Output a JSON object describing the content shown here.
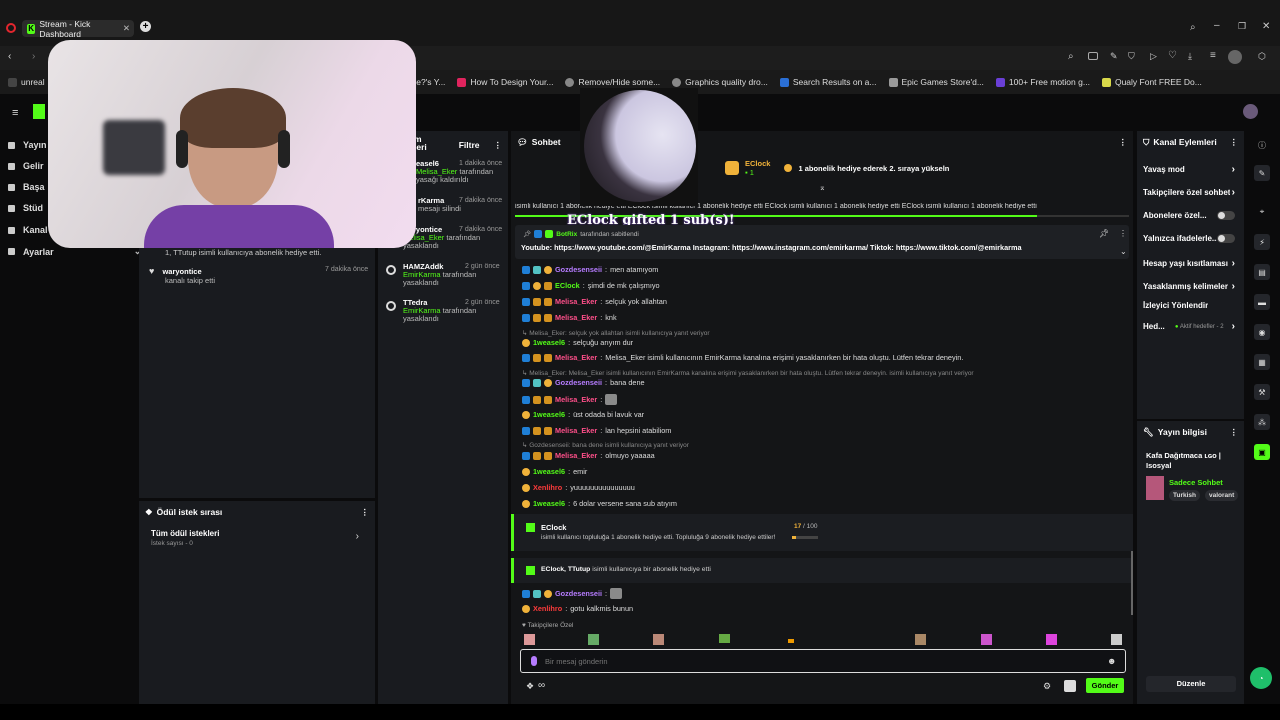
{
  "browser": {
    "tab_title": "Stream - Kick Dashboard",
    "new_tab": "+"
  },
  "bookmarks": [
    "unreal",
    "O İşe?'s Y...",
    "How To Design Your...",
    "Remove/Hide some...",
    "Graphics quality dro...",
    "Search Results on a...",
    "Epic Games Store'd...",
    "100+ Free motion g...",
    "Qualy Font FREE Do..."
  ],
  "nav": [
    "Yayın",
    "Gelir",
    "Başa",
    "Stüd",
    "Kanal",
    "Ayarlar"
  ],
  "activity": {
    "header_1": "m",
    "header_2": "leri",
    "filter_label": "Filtre",
    "left": [
      {
        "name": "",
        "text": "1, TTutup isimli kullanıcıya abonelik hediye etti.",
        "time": ""
      },
      {
        "name": "waryontice",
        "text": "kanalı takip etti",
        "time": "7 dakika önce"
      }
    ],
    "right": [
      {
        "name": "easel6",
        "by": "Melisa_Eker",
        "action": "tarafından yasağı kaldırıldı",
        "time": "1 dakika önce"
      },
      {
        "name": "rKarma",
        "by": "",
        "action": "mesajı silindi",
        "time": "7 dakika önce"
      },
      {
        "name": "waryontice",
        "by": "Melisa_Eker",
        "action": "tarafından yasaklandı",
        "time": "7 dakika önce"
      },
      {
        "name": "HAMZAddk",
        "by": "EmirKarma",
        "action": "tarafından yasaklandı",
        "time": "2 gün önce"
      },
      {
        "name": "TTedra",
        "by": "EmirKarma",
        "action": "tarafından yasaklandı",
        "time": "2 gün önce"
      }
    ]
  },
  "rewards": {
    "title": "Ödül istek sırası",
    "all": "Tüm ödül istekleri",
    "count": "İstek sayısı - 0"
  },
  "chat": {
    "title": "Sohbet",
    "top_gifter": "EClock",
    "top_gifter_count": "1",
    "top_text": "1 abonelik hediye ederek 2. sıraya yükseln",
    "ticker": "isimli kullanıcı 1 abonelik hediye etti   EClock isimli kullanıcı 1 abonelik hediye etti   EClock isimli kullanıcı 1 abonelik hediye etti   EClock isimli kullanıcı 1 abonelik hediye etti",
    "overlay": "EClock gifted 1 sub(s)!",
    "pinned_by": "BotRix",
    "pinned_action": "tarafından sabitlendi",
    "pinned_text": "Youtube: https://www.youtube.com/@EmirKarma Instagram: https://www.instagram.com/emirkarma/ Tiktok: https://www.tiktok.com/@emirkarma",
    "messages": [
      {
        "user": "Gozdesenseii",
        "color": "#b67cff",
        "badges": [
          "vip",
          "og",
          "sub"
        ],
        "text": "men atamıyom"
      },
      {
        "user": "EClock",
        "color": "#53fc18",
        "badges": [
          "vip",
          "sub",
          "m"
        ],
        "text": "şimdi de mk çalışmıyo"
      },
      {
        "user": "Melisa_Eker",
        "color": "#ff4f8a",
        "badges": [
          "vip",
          "m",
          "m"
        ],
        "text": "selçuk yok allahtan"
      },
      {
        "user": "Melisa_Eker",
        "color": "#ff4f8a",
        "badges": [
          "vip",
          "m",
          "m"
        ],
        "text": "knk"
      },
      {
        "reply": "Melisa_Eker: selçuk yok allahtan isimli kullanıcıya yanıt veriyor"
      },
      {
        "user": "1weasel6",
        "color": "#53fc18",
        "badges": [
          "sub"
        ],
        "text": "selçuğu arıyım dur"
      },
      {
        "user": "Melisa_Eker",
        "color": "#ff4f8a",
        "badges": [
          "vip",
          "m",
          "m"
        ],
        "text": "Melisa_Eker isimli kullanıcının EmirKarma kanalına erişimi yasaklanırken bir hata oluştu. Lütfen tekrar deneyin."
      },
      {
        "reply": "Melisa_Eker: Melisa_Eker isimli kullanıcının EmirKarma kanalına erişimi yasaklanırken bir hata oluştu. Lütfen tekrar deneyin. isimli kullanıcıya yanıt veriyor"
      },
      {
        "user": "Gozdesenseii",
        "color": "#b67cff",
        "badges": [
          "vip",
          "og",
          "sub"
        ],
        "text": "bana dene"
      },
      {
        "user": "Melisa_Eker",
        "color": "#ff4f8a",
        "badges": [
          "vip",
          "m",
          "m"
        ],
        "text": ""
      },
      {
        "user": "1weasel6",
        "color": "#53fc18",
        "badges": [
          "sub"
        ],
        "text": "üst odada bi lavuk var"
      },
      {
        "user": "Melisa_Eker",
        "color": "#ff4f8a",
        "badges": [
          "vip",
          "m",
          "m"
        ],
        "text": "lan hepsini atabiliom"
      },
      {
        "reply": "Gozdesenseii: bana dene isimli kullanıcıya yanıt veriyor"
      },
      {
        "user": "Melisa_Eker",
        "color": "#ff4f8a",
        "badges": [
          "vip",
          "m",
          "m"
        ],
        "text": "olmuyo yaaaaa"
      },
      {
        "user": "1weasel6",
        "color": "#53fc18",
        "badges": [
          "sub"
        ],
        "text": "emir"
      },
      {
        "user": "Xenlihro",
        "color": "#ff3b3b",
        "badges": [
          "sub"
        ],
        "text": "yuuuuuuuuuuuuuuu"
      },
      {
        "user": "1weasel6",
        "color": "#53fc18",
        "badges": [
          "sub"
        ],
        "text": "6 dolar versene sana sub atıyım"
      }
    ],
    "goal": {
      "user": "EClock",
      "text": "isimli kullanıcı topluluğa 1 abonelik hediye etti. Topluluğa 9 abonelik hediye ettiler!",
      "progress": "17",
      "total": "/ 100",
      "fraction": 0.17
    },
    "gift": {
      "users": "EClock, TTutup",
      "text": "isimli kullanıcıya bir abonelik hediye etti"
    },
    "after": [
      {
        "user": "Gozdesenseii",
        "color": "#b67cff",
        "badges": [
          "vip",
          "og",
          "sub"
        ],
        "text": ""
      },
      {
        "user": "Xenlihro",
        "color": "#ff3b3b",
        "badges": [
          "sub"
        ],
        "text": "gotu kalkmis bunun"
      }
    ],
    "followers_only": "Takipçilere Özel",
    "input_placeholder": "Bir mesaj gönderin",
    "send": "Gönder"
  },
  "channel_actions": {
    "title": "Kanal Eylemleri",
    "items": [
      {
        "label": "Yavaş mod",
        "kind": "arrow"
      },
      {
        "label": "Takipçilere özel sohbet",
        "kind": "arrow"
      },
      {
        "label": "Abonelere özel...",
        "kind": "toggle"
      },
      {
        "label": "Yalnızca ifadelerle...",
        "kind": "toggle"
      },
      {
        "label": "Hesap yaşı kısıtlaması",
        "kind": "arrow"
      },
      {
        "label": "Yasaklanmış kelimeler",
        "kind": "arrow"
      },
      {
        "label": "İzleyici Yönlendir",
        "kind": "none"
      },
      {
        "label": "Hed...",
        "kind": "arrow",
        "extra": "Aktif hedefler - 2"
      }
    ]
  },
  "stream_info": {
    "title": "Yayın bilgisi",
    "stream_title": "Kafa Dağıtmaca ʟɢᴏ | Isosyal",
    "mode": "Sadece Sohbet",
    "tags": [
      "Turkish",
      "valorant"
    ],
    "edit": "Düzenle"
  }
}
